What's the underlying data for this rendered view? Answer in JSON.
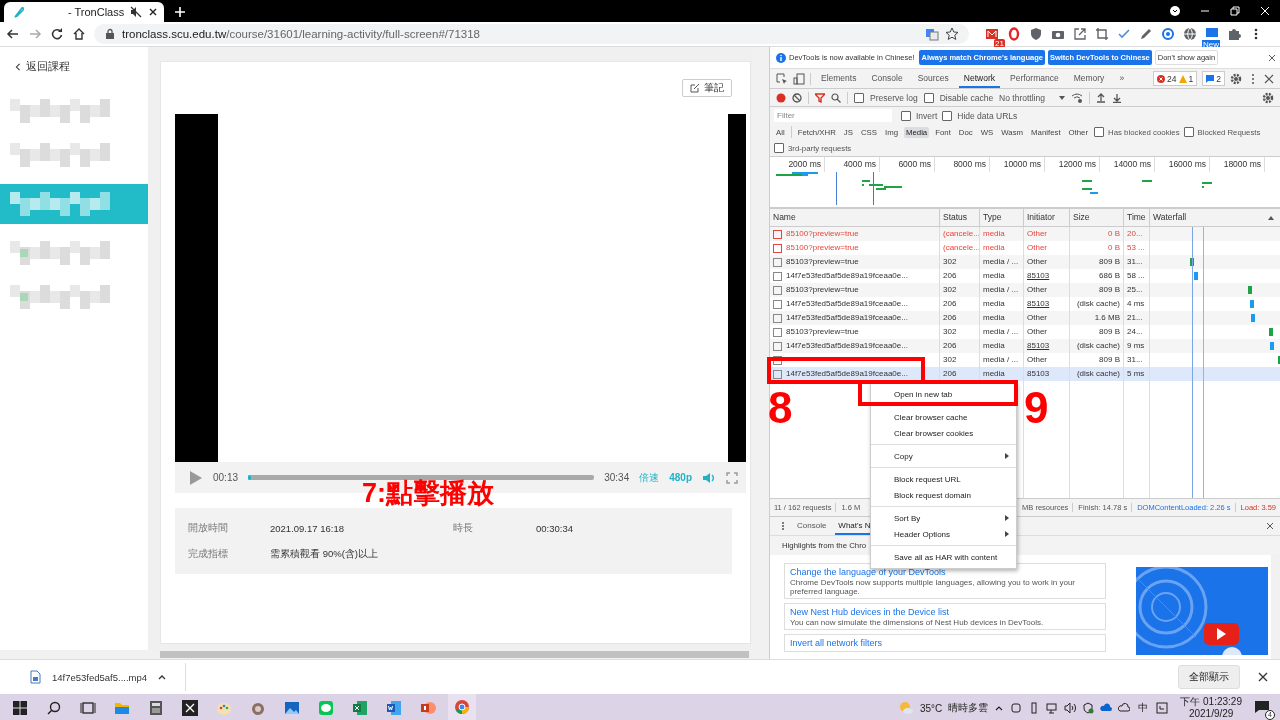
{
  "browser": {
    "tab": {
      "title": "- TronClass",
      "selected": true
    },
    "url": {
      "host": "tronclass.scu.edu.tw",
      "path": "/course/31601/learning-activity/full-screen#/71318"
    },
    "extension_badge": "21",
    "new_badge": "New"
  },
  "sidebar": {
    "back_link": "返回課程",
    "items": [
      {
        "selected": false
      },
      {
        "selected": false
      },
      {
        "selected": true
      },
      {
        "selected": false
      },
      {
        "selected": false
      }
    ]
  },
  "lesson": {
    "note_button": "筆記",
    "player": {
      "current": "00:13",
      "progress": {
        "level": 0.01
      },
      "duration": "30:34",
      "speed": "倍速",
      "quality": "480p"
    },
    "info": [
      {
        "label": "開放時間",
        "value": "2021.09.17 16:18"
      },
      {
        "label": "時長",
        "value": "00:30:34"
      },
      {
        "label": "完成指標",
        "value": "需累積觀看 90%(含)以上"
      }
    ]
  },
  "devtools": {
    "banner": {
      "message": "DevTools is now available in Chinese!",
      "buttons": [
        {
          "label": "Always match Chrome's language",
          "kind": "primary"
        },
        {
          "label": "Switch DevTools to Chinese",
          "kind": "primary"
        },
        {
          "label": "Don't show again",
          "kind": "secondary"
        }
      ]
    },
    "panels": [
      {
        "label": "Elements",
        "selected": false
      },
      {
        "label": "Console",
        "selected": false
      },
      {
        "label": "Sources",
        "selected": false
      },
      {
        "label": "Network",
        "selected": true
      },
      {
        "label": "Performance",
        "selected": false
      },
      {
        "label": "Memory",
        "selected": false
      }
    ],
    "more": "»",
    "errors": "24",
    "warnings": "1",
    "issues": "2",
    "toolbar": {
      "recording": true,
      "preserve_log": {
        "label": "Preserve log",
        "checked": false
      },
      "disable_cache": {
        "label": "Disable cache",
        "checked": false
      },
      "throttling": "No throttling"
    },
    "filter": {
      "placeholder": "Filter",
      "invert": {
        "label": "Invert",
        "checked": false
      },
      "hide_data_urls": {
        "label": "Hide data URLs",
        "checked": false
      }
    },
    "types": [
      {
        "label": "All",
        "selected": false
      },
      {
        "label": "Fetch/XHR",
        "selected": false
      },
      {
        "label": "JS",
        "selected": false
      },
      {
        "label": "CSS",
        "selected": false
      },
      {
        "label": "Img",
        "selected": false
      },
      {
        "label": "Media",
        "selected": true
      },
      {
        "label": "Font",
        "selected": false
      },
      {
        "label": "Doc",
        "selected": false
      },
      {
        "label": "WS",
        "selected": false
      },
      {
        "label": "Wasm",
        "selected": false
      },
      {
        "label": "Manifest",
        "selected": false
      },
      {
        "label": "Other",
        "selected": false
      }
    ],
    "blocked_cookies": {
      "label": "Has blocked cookies",
      "checked": false
    },
    "blocked_requests": {
      "label": "Blocked Requests",
      "checked": false
    },
    "third_party": {
      "label": "3rd-party requests",
      "checked": false
    },
    "overview_ticks": [
      "2000 ms",
      "4000 ms",
      "6000 ms",
      "8000 ms",
      "10000 ms",
      "12000 ms",
      "14000 ms",
      "16000 ms",
      "18000 ms"
    ],
    "columns": [
      "Name",
      "Status",
      "Type",
      "Initiator",
      "Size",
      "Time",
      "Waterfall"
    ],
    "rows": [
      {
        "name": "85100?preview=true",
        "status": "(cancele...",
        "type": "media",
        "initiator": "Other",
        "initiator_underlined": false,
        "size": "0 B",
        "time": "20...",
        "failed": true,
        "selected": false
      },
      {
        "name": "85100?preview=true",
        "status": "(cancele...",
        "type": "media",
        "initiator": "Other",
        "initiator_underlined": false,
        "size": "0 B",
        "time": "53 ...",
        "failed": true,
        "selected": false
      },
      {
        "name": "85103?preview=true",
        "status": "302",
        "type": "media / ...",
        "initiator": "Other",
        "initiator_underlined": false,
        "size": "809 B",
        "time": "31...",
        "failed": false,
        "selected": false
      },
      {
        "name": "14f7e53fed5af5de89a19fceaa0e...",
        "status": "206",
        "type": "media",
        "initiator": "85103",
        "initiator_underlined": true,
        "size": "686 B",
        "time": "58 ...",
        "failed": false,
        "selected": false
      },
      {
        "name": "85103?preview=true",
        "status": "302",
        "type": "media / ...",
        "initiator": "Other",
        "initiator_underlined": false,
        "size": "809 B",
        "time": "25...",
        "failed": false,
        "selected": false
      },
      {
        "name": "14f7e53fed5af5de89a19fceaa0e...",
        "status": "206",
        "type": "media",
        "initiator": "85103",
        "initiator_underlined": true,
        "size": "(disk cache)",
        "time": "4 ms",
        "failed": false,
        "selected": false
      },
      {
        "name": "14f7e53fed5af5de89a19fceaa0e...",
        "status": "206",
        "type": "media",
        "initiator": "Other",
        "initiator_underlined": false,
        "size": "1.6 MB",
        "time": "21...",
        "failed": false,
        "selected": false
      },
      {
        "name": "85103?preview=true",
        "status": "302",
        "type": "media / ...",
        "initiator": "Other",
        "initiator_underlined": false,
        "size": "809 B",
        "time": "24...",
        "failed": false,
        "selected": false
      },
      {
        "name": "14f7e53fed5af5de89a19fceaa0e...",
        "status": "206",
        "type": "media",
        "initiator": "85103",
        "initiator_underlined": true,
        "size": "(disk cache)",
        "time": "9 ms",
        "failed": false,
        "selected": false
      },
      {
        "status": "302",
        "type": "media / ...",
        "initiator": "Other",
        "initiator_underlined": false,
        "size": "809 B",
        "time": "31...",
        "failed": false,
        "selected": false
      },
      {
        "name": "14f7e53fed5af5de89a19fceaa0e...",
        "status": "206",
        "type": "media",
        "initiator": "85103",
        "initiator_underlined": false,
        "size": "(disk cache)",
        "time": "5 ms",
        "failed": false,
        "selected": true
      }
    ],
    "context_menu": {
      "groups": [
        {
          "items": [
            {
              "label": "Open in new tab",
              "submenu": false
            }
          ]
        },
        {
          "items": [
            {
              "label": "Clear browser cache",
              "submenu": false
            },
            {
              "label": "Clear browser cookies",
              "submenu": false
            }
          ]
        },
        {
          "items": [
            {
              "label": "Copy",
              "submenu": true
            }
          ]
        },
        {
          "items": [
            {
              "label": "Block request URL",
              "submenu": false
            },
            {
              "label": "Block request domain",
              "submenu": false
            }
          ]
        },
        {
          "items": [
            {
              "label": "Sort By",
              "submenu": true
            },
            {
              "label": "Header Options",
              "submenu": true
            }
          ]
        },
        {
          "items": [
            {
              "label": "Save all as HAR with content",
              "submenu": false
            }
          ]
        }
      ]
    },
    "summary": [
      {
        "text": "11 / 162 requests",
        "kind": "count"
      },
      {
        "text": "1.6 M",
        "kind": "partial"
      },
      {
        "text": "MB resources",
        "kind": "plain"
      },
      {
        "text": "Finish: 14.78 s",
        "kind": "plain"
      },
      {
        "text": "DOMContentLoaded: 2.26 s",
        "kind": "dcl"
      },
      {
        "text": "Load: 3.59",
        "kind": "load"
      }
    ],
    "drawer": {
      "tabs": [
        {
          "label": "Console",
          "selected": false
        },
        {
          "label": "What's N",
          "selected": true
        }
      ],
      "highlights": "Highlights from the Chro",
      "cards": [
        {
          "title": "Change the language of your DevTools",
          "body": "Chrome DevTools now supports multiple languages, allowing you to work in your preferred language."
        },
        {
          "title": "New Nest Hub devices in the Device list",
          "body": "You can now simulate the dimensions of Nest Hub devices in DevTools."
        },
        {
          "title": "Invert all network filters"
        }
      ]
    }
  },
  "annotations": [
    {
      "text": "7:點擊播放"
    },
    {
      "text": "8"
    },
    {
      "text": "9"
    }
  ],
  "downloads": {
    "file": "14f7e53fed5af5....mp4",
    "show_all": "全部顯示"
  },
  "taskbar": {
    "apps": [
      {
        "kind": "start",
        "selected": false
      },
      {
        "kind": "search",
        "selected": false
      },
      {
        "kind": "taskview",
        "selected": false
      },
      {
        "kind": "explorer",
        "selected": false
      },
      {
        "kind": "calculator",
        "selected": false
      },
      {
        "kind": "snip",
        "selected": false
      },
      {
        "kind": "paint",
        "selected": false
      },
      {
        "kind": "gimp",
        "selected": false
      },
      {
        "kind": "photos",
        "selected": false
      },
      {
        "kind": "chat",
        "selected": false
      },
      {
        "kind": "excel",
        "selected": false
      },
      {
        "kind": "word",
        "selected": false
      },
      {
        "kind": "powerpoint",
        "selected": false
      },
      {
        "kind": "chrome",
        "selected": true
      }
    ],
    "temperature": "35°C",
    "weather": "晴時多雲",
    "ime": "中",
    "time": "下午 01:23:29",
    "date": "2021/9/29",
    "notifications": "4"
  }
}
